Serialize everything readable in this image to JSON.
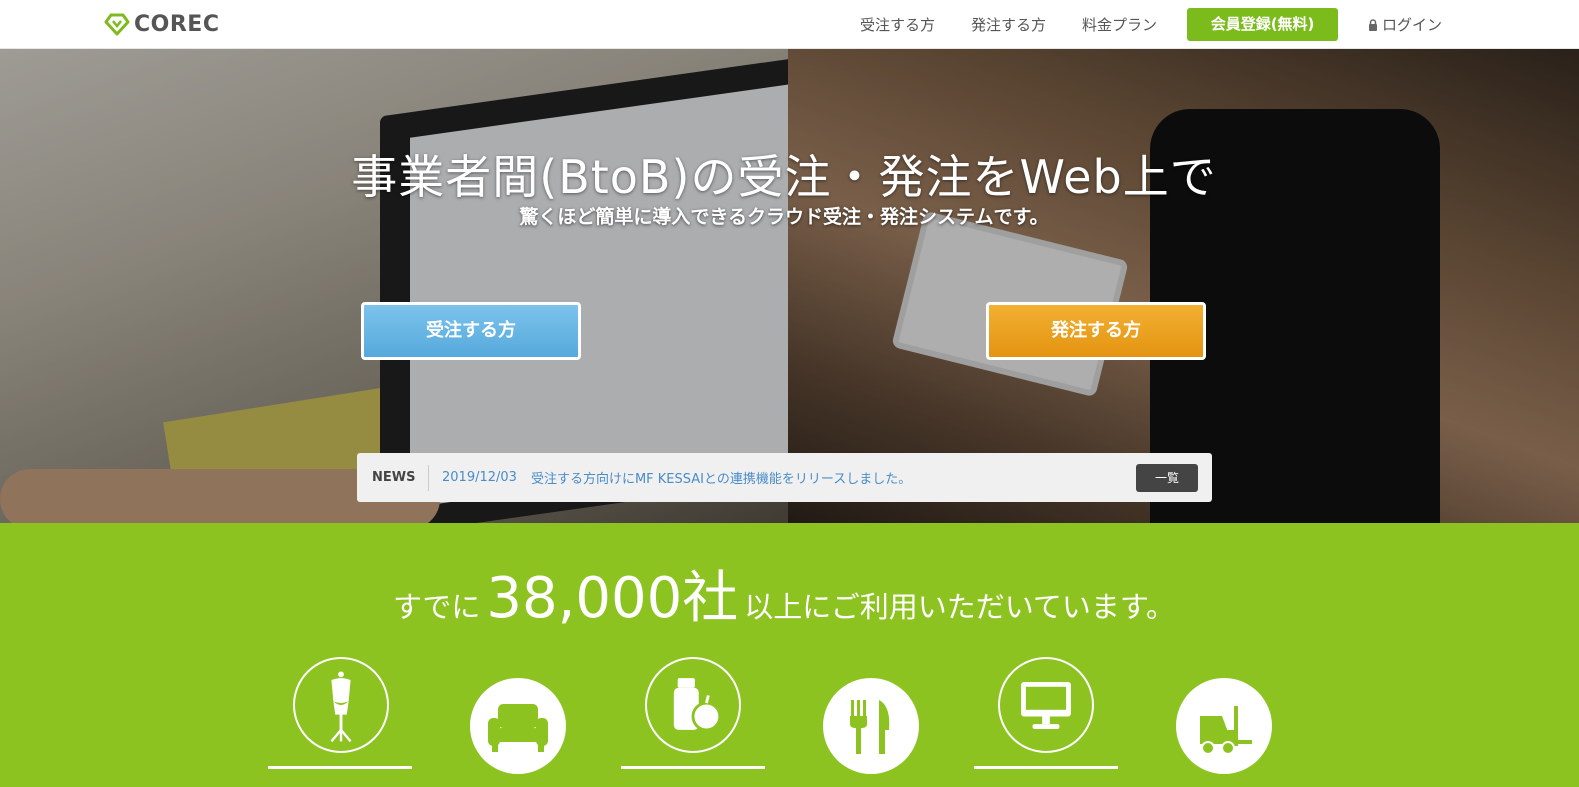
{
  "header": {
    "logo_text": "COREC",
    "nav": {
      "receive": "受注する方",
      "order": "発注する方",
      "pricing": "料金プラン",
      "register": "会員登録(無料)",
      "login": "ログイン"
    }
  },
  "hero": {
    "title": "事業者間(BtoB)の受注・発注をWeb上で",
    "subtitle": "驚くほど簡単に導入できるクラウド受注・発注システムです。",
    "cta_receive": "受注する方",
    "cta_order": "発注する方"
  },
  "news": {
    "label": "NEWS",
    "date": "2019/12/03",
    "text": "受注する方向けにMF KESSAIとの連携機能をリリースしました。",
    "list_button": "一覧"
  },
  "stats": {
    "prefix": "すでに",
    "number": "38,000社",
    "suffix": "以上にご利用いただいています。"
  },
  "industries": [
    {
      "icon": "mannequin-icon"
    },
    {
      "icon": "sofa-icon"
    },
    {
      "icon": "food-bottle-apple-icon"
    },
    {
      "icon": "fork-knife-icon"
    },
    {
      "icon": "monitor-icon"
    },
    {
      "icon": "forklift-icon"
    }
  ],
  "colors": {
    "brand_green": "#7cbb1c",
    "section_green": "#8dc321",
    "cta_blue": "#56a9dc",
    "cta_orange": "#e39411",
    "news_link": "#4a8cc8"
  }
}
